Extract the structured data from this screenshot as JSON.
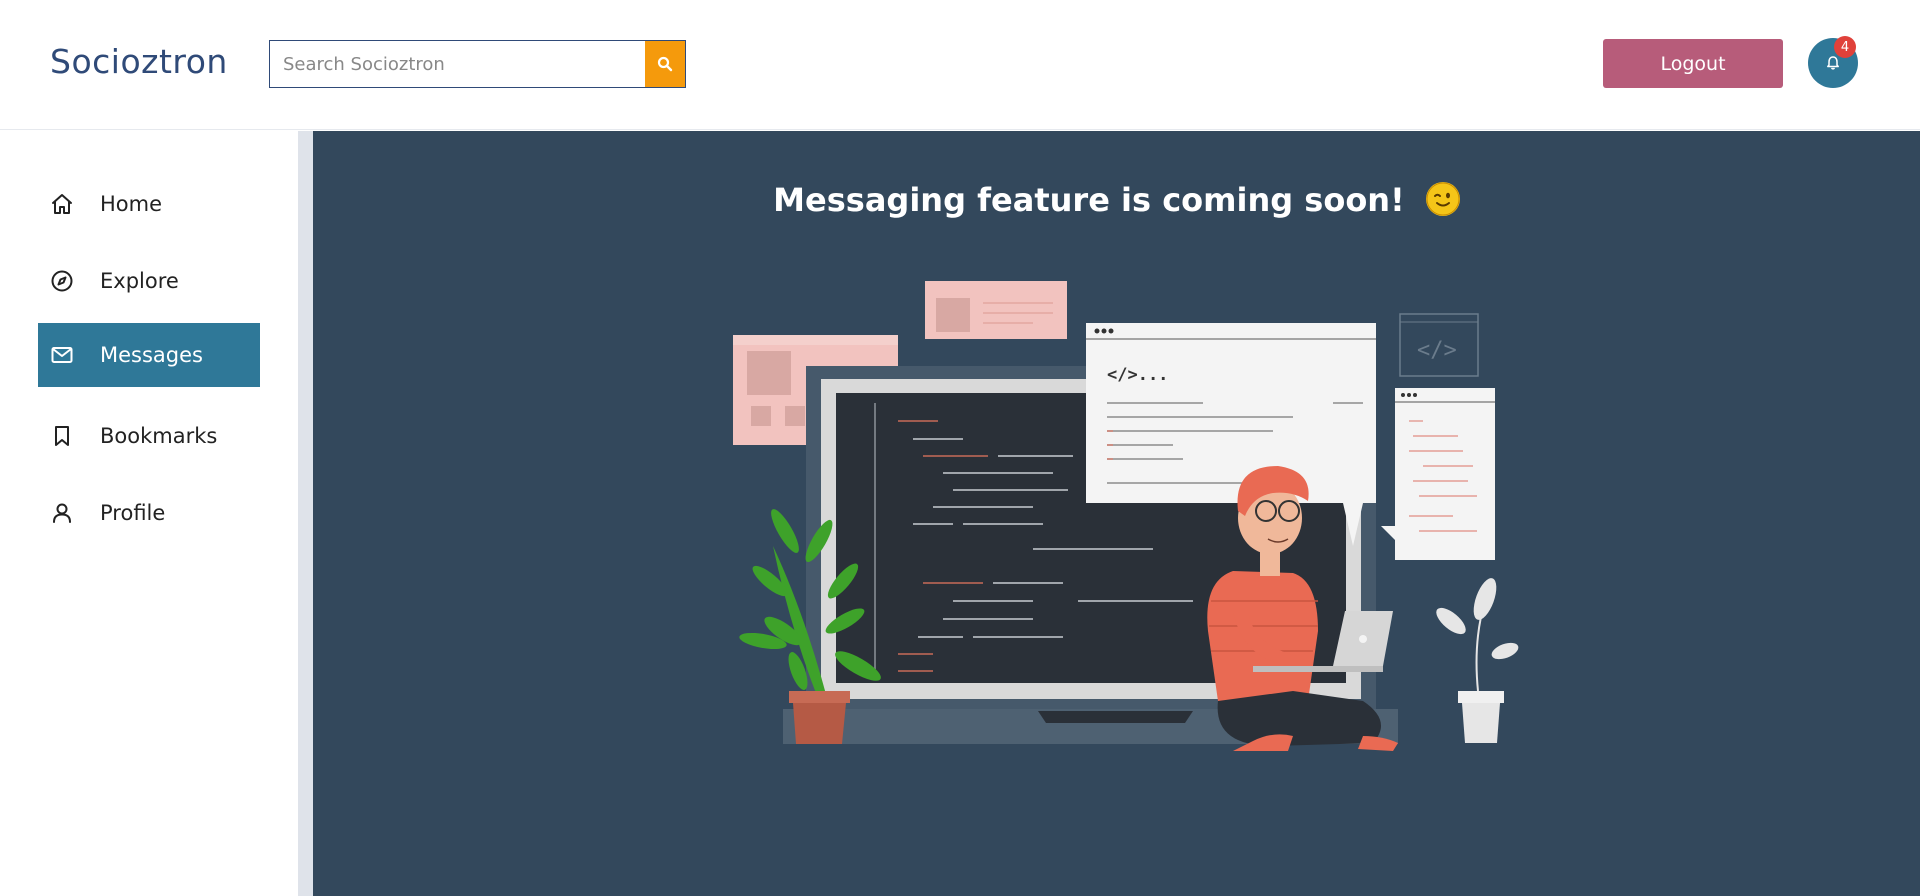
{
  "app": {
    "name": "Socioztron"
  },
  "search": {
    "placeholder": "Search Socioztron",
    "icon": "search-icon"
  },
  "header": {
    "logout_label": "Logout",
    "notification_count": "4"
  },
  "sidebar": {
    "items": [
      {
        "label": "Home",
        "icon": "home-icon",
        "active": false
      },
      {
        "label": "Explore",
        "icon": "compass-icon",
        "active": false
      },
      {
        "label": "Messages",
        "icon": "mail-icon",
        "active": true
      },
      {
        "label": "Bookmarks",
        "icon": "bookmark-icon",
        "active": false
      },
      {
        "label": "Profile",
        "icon": "user-icon",
        "active": false
      }
    ]
  },
  "main": {
    "headline": "Messaging feature is coming soon!",
    "code_snippet": "</>..."
  },
  "colors": {
    "brand": "#2f4a78",
    "accent_search": "#f59a0c",
    "logout": "#b75c7a",
    "active_nav": "#2f7898",
    "main_bg": "#33485c",
    "badge": "#e0413a"
  }
}
